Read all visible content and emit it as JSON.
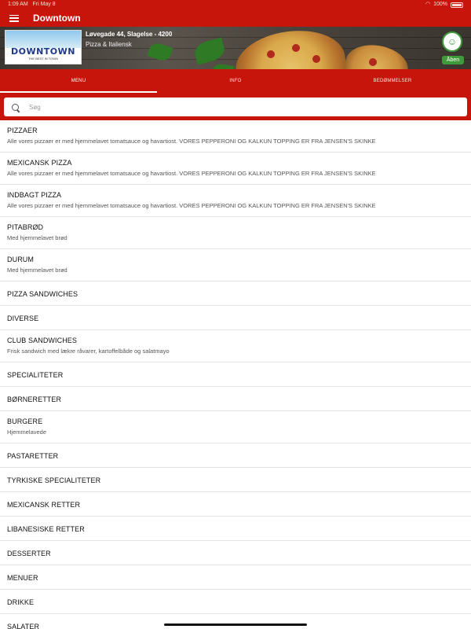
{
  "status_bar": {
    "time": "1:09 AM",
    "date": "Fri May 8",
    "battery": "100%"
  },
  "app": {
    "title": "Downtown"
  },
  "restaurant": {
    "logo_text": "DOWNTOWN",
    "logo_sub": "THE BEST IN TOWN",
    "address": "Løvegade 44, Slagelse - 4200",
    "category": "Pizza & Italiensk",
    "status": "Åben"
  },
  "tabs": [
    {
      "label": "MENU",
      "active": true
    },
    {
      "label": "INFO",
      "active": false
    },
    {
      "label": "BEDØMMELSER",
      "active": false
    }
  ],
  "search": {
    "placeholder": "Søg",
    "value": ""
  },
  "colors": {
    "brand_red": "#c8150b",
    "open_green": "#3f9a3a"
  },
  "menu": [
    {
      "title": "PIZZAER",
      "desc": "Alle vores pizzaer er med hjemmelavet tomatsauce og havartiost. VORES PEPPERONI OG KALKUN TOPPING ER FRA JENSEN'S SKINKE"
    },
    {
      "title": "MEXICANSK PIZZA",
      "desc": "Alle vores pizzaer er med hjemmelavet tomatsauce og havartiost. VORES PEPPERONI OG KALKUN TOPPING ER FRA JENSEN'S SKINKE"
    },
    {
      "title": "INDBAGT PIZZA",
      "desc": "Alle vores pizzaer er med hjemmelavet tomatsauce og havartiost. VORES PEPPERONI OG KALKUN TOPPING ER FRA JENSEN'S SKINKE"
    },
    {
      "title": "PITABRØD",
      "desc": "Med hjemmelavet brød"
    },
    {
      "title": "DURUM",
      "desc": "Med hjemmelavet brød"
    },
    {
      "title": "PIZZA SANDWICHES",
      "desc": ""
    },
    {
      "title": "DIVERSE",
      "desc": ""
    },
    {
      "title": "CLUB SANDWICHES",
      "desc": "Frisk sandwich med lækre råvarer, kartoffelbåde og salatmayo"
    },
    {
      "title": "SPECIALITETER",
      "desc": ""
    },
    {
      "title": "BØRNERETTER",
      "desc": ""
    },
    {
      "title": "BURGERE",
      "desc": "Hjemmelavede"
    },
    {
      "title": "PASTARETTER",
      "desc": ""
    },
    {
      "title": "TYRKISKE SPECIALITETER",
      "desc": ""
    },
    {
      "title": "MEXICANSK RETTER",
      "desc": ""
    },
    {
      "title": "LIBANESISKE RETTER",
      "desc": ""
    },
    {
      "title": "DESSERTER",
      "desc": ""
    },
    {
      "title": "MENUER",
      "desc": ""
    },
    {
      "title": "DRIKKE",
      "desc": ""
    },
    {
      "title": "SALATER",
      "desc": ""
    }
  ]
}
